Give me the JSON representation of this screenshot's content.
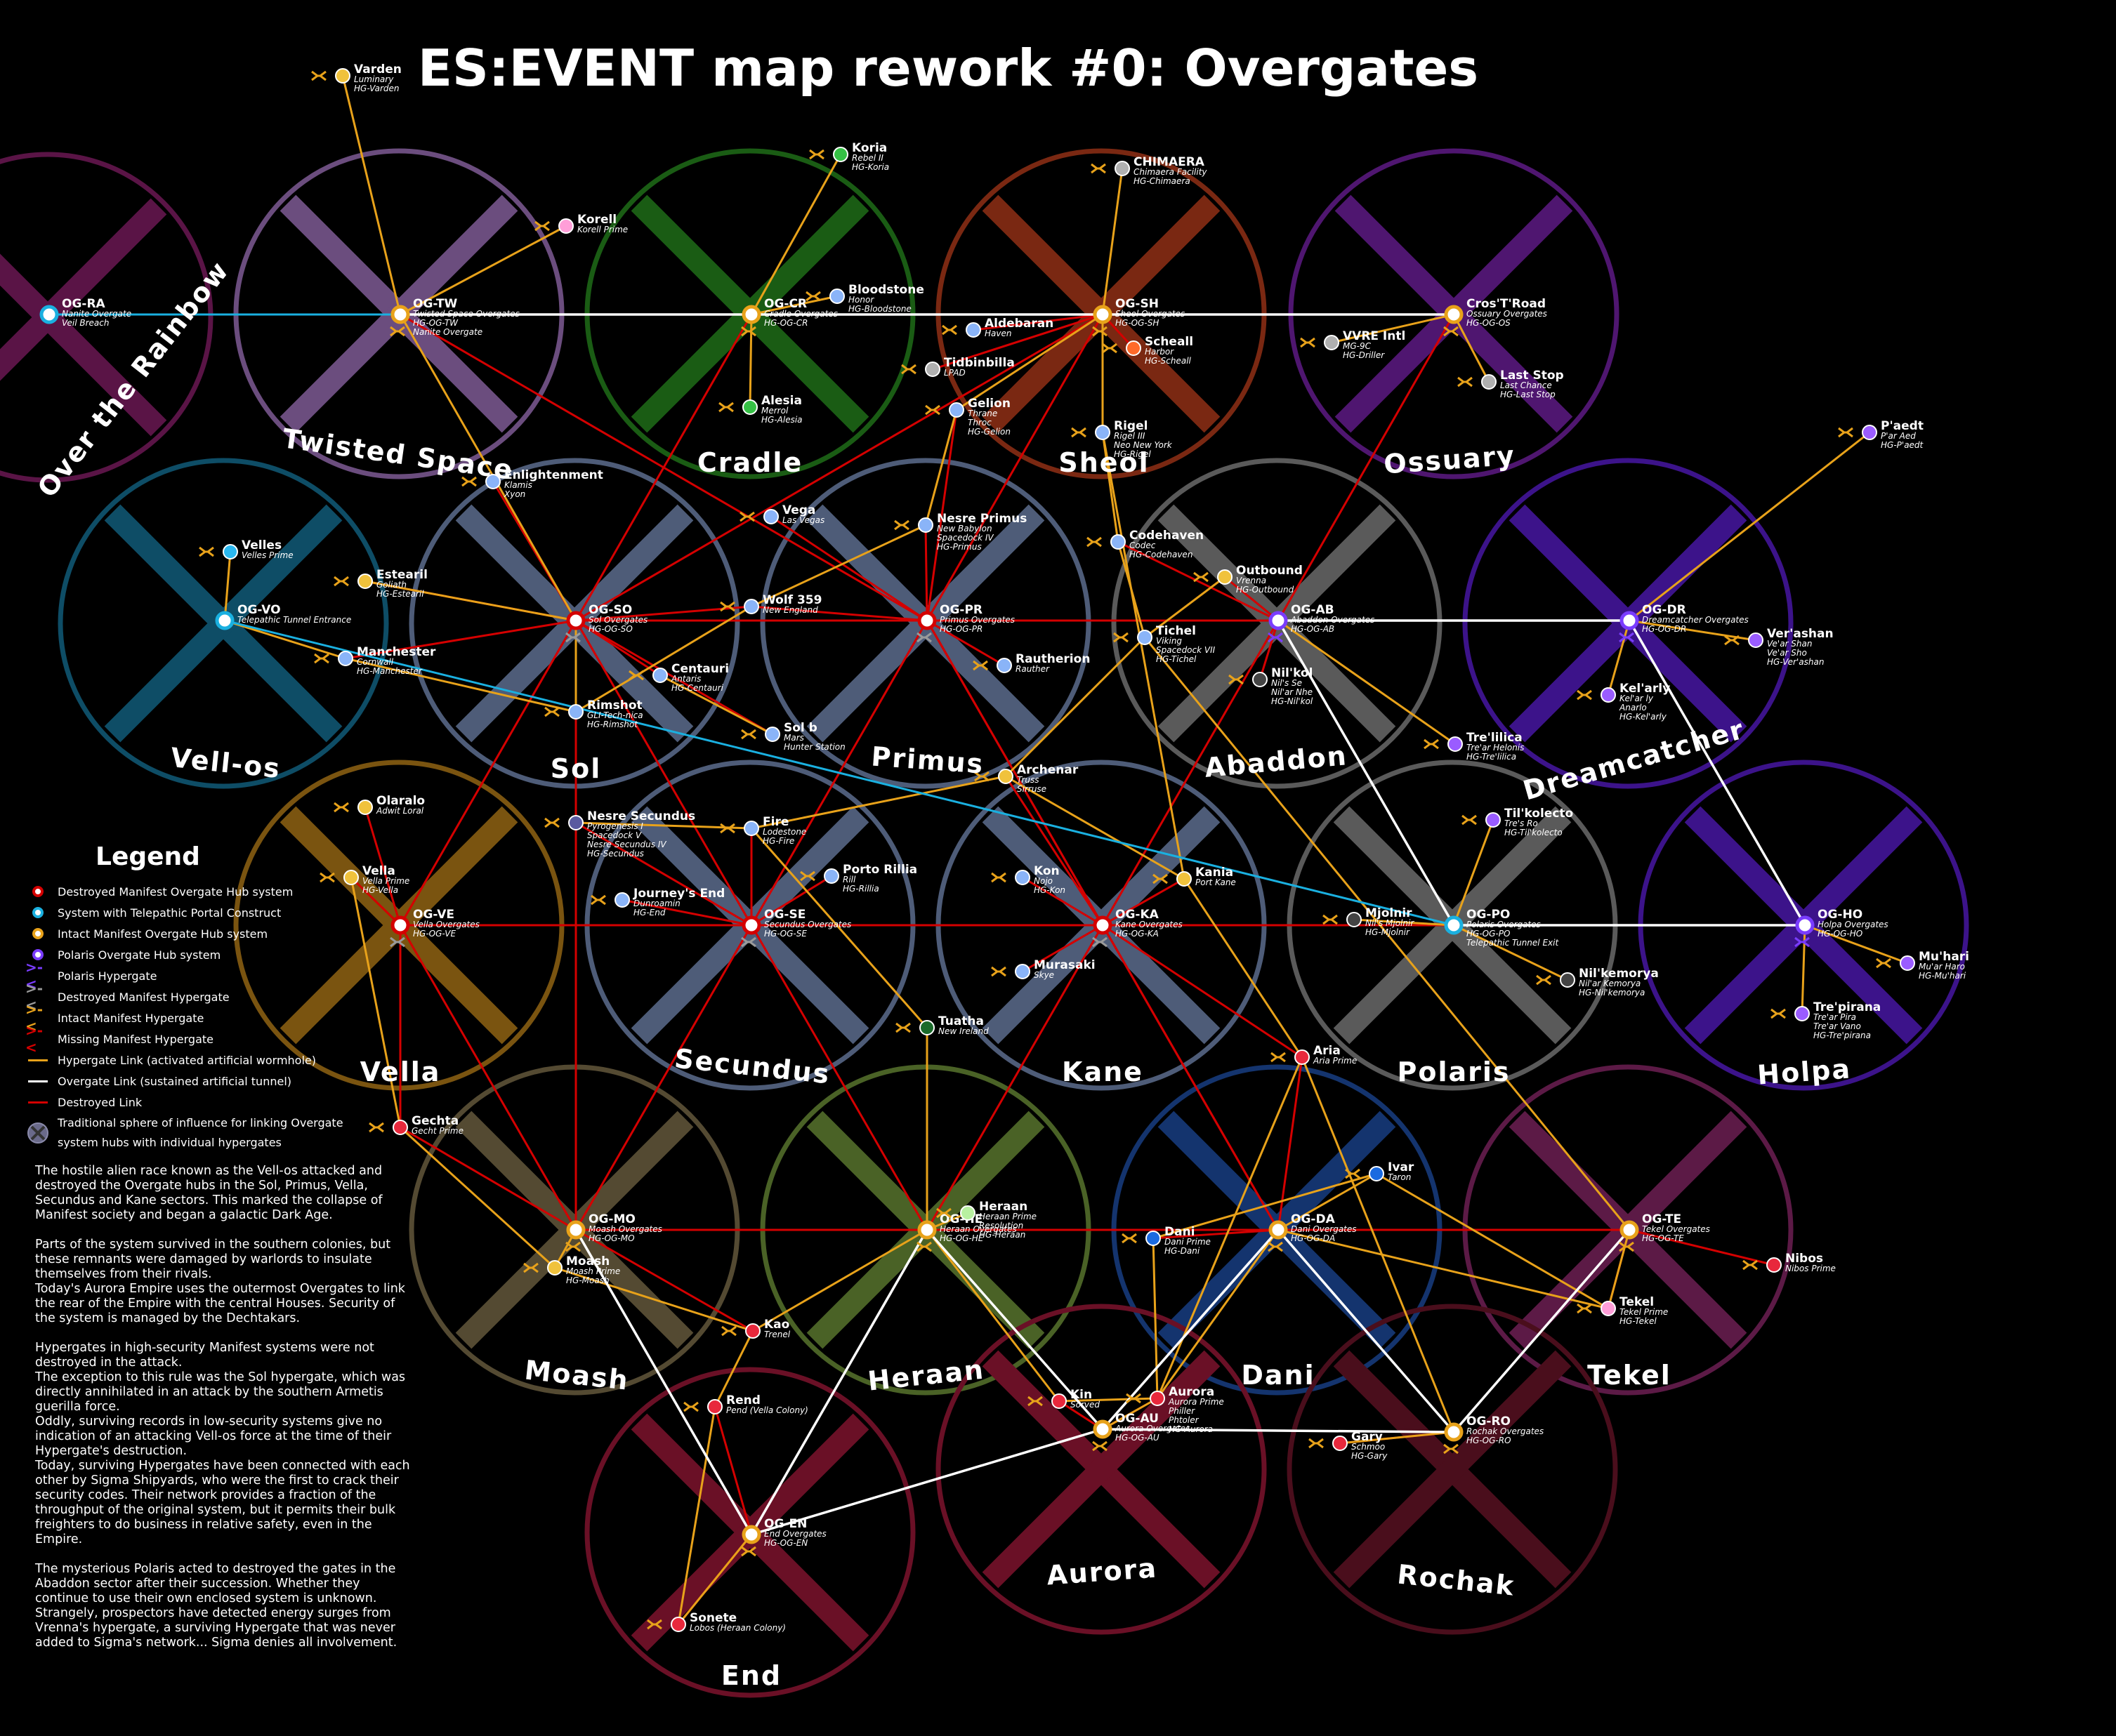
{
  "title": "ES:EVENT map rework #0: Overgates",
  "colors": {
    "background": "#000000",
    "destroyed_link": "#d40000",
    "hypergate_link": "#e8a21a",
    "overgate_link": "#ffffff",
    "telepathic_link": "#1ab0e0"
  },
  "regions": [
    {
      "id": "over-the-rainbow",
      "name": "Over the Rainbow",
      "color": "#5a1446"
    },
    {
      "id": "twisted-space",
      "name": "Twisted Space",
      "color": "#6b4d7e"
    },
    {
      "id": "cradle",
      "name": "Cradle",
      "color": "#1a5c14"
    },
    {
      "id": "sheol",
      "name": "Sheol",
      "color": "#7a2812"
    },
    {
      "id": "ossuary",
      "name": "Ossuary",
      "color": "#4f1670"
    },
    {
      "id": "vell-os",
      "name": "Vell-os",
      "color": "#0e4d66"
    },
    {
      "id": "sol",
      "name": "Sol",
      "color": "#4e5c78"
    },
    {
      "id": "primus",
      "name": "Primus",
      "color": "#4e5c78"
    },
    {
      "id": "abaddon",
      "name": "Abaddon",
      "color": "#5a5a5a"
    },
    {
      "id": "dreamcatcher",
      "name": "Dreamcatcher",
      "color": "#3c138a"
    },
    {
      "id": "vella",
      "name": "Vella",
      "color": "#7a5410"
    },
    {
      "id": "secundus",
      "name": "Secundus",
      "color": "#4e5c78"
    },
    {
      "id": "kane",
      "name": "Kane",
      "color": "#4e5c78"
    },
    {
      "id": "polaris",
      "name": "Polaris",
      "color": "#5a5a5a"
    },
    {
      "id": "holpa",
      "name": "Holpa",
      "color": "#3c138a"
    },
    {
      "id": "moash",
      "name": "Moash",
      "color": "#544a32"
    },
    {
      "id": "heraan",
      "name": "Heraan",
      "color": "#4a6226"
    },
    {
      "id": "dani",
      "name": "Dani",
      "color": "#14346e"
    },
    {
      "id": "tekel",
      "name": "Tekel",
      "color": "#5c1a46"
    },
    {
      "id": "end",
      "name": "End",
      "color": "#6a1026"
    },
    {
      "id": "aurora",
      "name": "Aurora",
      "color": "#6a1026"
    },
    {
      "id": "rochak",
      "name": "Rochak",
      "color": "#4a0e1c"
    }
  ],
  "hubs": [
    {
      "id": "OG-RA",
      "label": "OG-RA",
      "sub": [
        "Nanite Overgate",
        "Veil Breach"
      ],
      "status": "telepathic"
    },
    {
      "id": "OG-TW",
      "label": "OG-TW",
      "sub": [
        "Twisted Space Overgates",
        "HG-OG-TW",
        "Nanite Overgate"
      ],
      "status": "intact"
    },
    {
      "id": "OG-CR",
      "label": "OG-CR",
      "sub": [
        "Cradle Overgates",
        "HG-OG-CR"
      ],
      "status": "intact"
    },
    {
      "id": "OG-SH",
      "label": "OG-SH",
      "sub": [
        "Sheol Overgates",
        "HG-OG-SH"
      ],
      "status": "intact"
    },
    {
      "id": "Cros'T'Road",
      "label": "Cros'T'Road",
      "sub": [
        "Ossuary Overgates",
        "HG-OG-OS"
      ],
      "status": "intact"
    },
    {
      "id": "OG-VO",
      "label": "OG-VO",
      "sub": [
        "Telepathic Tunnel Entrance"
      ],
      "status": "telepathic"
    },
    {
      "id": "OG-SO",
      "label": "OG-SO",
      "sub": [
        "Sol Overgates",
        "HG-OG-SO"
      ],
      "status": "destroyed"
    },
    {
      "id": "OG-PR",
      "label": "OG-PR",
      "sub": [
        "Primus Overgates",
        "HG-OG-PR"
      ],
      "status": "destroyed"
    },
    {
      "id": "OG-AB",
      "label": "OG-AB",
      "sub": [
        "Abaddon Overgates",
        "HG-OG-AB"
      ],
      "status": "polaris"
    },
    {
      "id": "OG-DR",
      "label": "OG-DR",
      "sub": [
        "Dreamcatcher Overgates",
        "HG-OG-DR"
      ],
      "status": "polaris"
    },
    {
      "id": "OG-VE",
      "label": "OG-VE",
      "sub": [
        "Vella Overgates",
        "HG-OG-VE"
      ],
      "status": "destroyed"
    },
    {
      "id": "OG-SE",
      "label": "OG-SE",
      "sub": [
        "Secundus Overgates",
        "HG-OG-SE"
      ],
      "status": "destroyed"
    },
    {
      "id": "OG-KA",
      "label": "OG-KA",
      "sub": [
        "Kane Overgates",
        "HG-OG-KA"
      ],
      "status": "destroyed"
    },
    {
      "id": "OG-PO",
      "label": "OG-PO",
      "sub": [
        "Polaris Overgates",
        "HG-OG-PO",
        "Telepathic Tunnel Exit"
      ],
      "status": "telepathic"
    },
    {
      "id": "OG-HO",
      "label": "OG-HO",
      "sub": [
        "Holpa Overgates",
        "HG-OG-HO"
      ],
      "status": "polaris"
    },
    {
      "id": "OG-MO",
      "label": "OG-MO",
      "sub": [
        "Moash Overgates",
        "HG-OG-MO"
      ],
      "status": "intact"
    },
    {
      "id": "OG-HE",
      "label": "OG-HE",
      "sub": [
        "Heraan Overgates",
        "HG-OG-HE"
      ],
      "status": "intact"
    },
    {
      "id": "OG-DA",
      "label": "OG-DA",
      "sub": [
        "Dani Overgates",
        "HG-OG-DA"
      ],
      "status": "intact"
    },
    {
      "id": "OG-TE",
      "label": "OG-TE",
      "sub": [
        "Tekel Overgates",
        "HG-OG-TE"
      ],
      "status": "intact"
    },
    {
      "id": "OG-EN",
      "label": "OG-EN",
      "sub": [
        "End Overgates",
        "HG-OG-EN"
      ],
      "status": "intact"
    },
    {
      "id": "OG-AU",
      "label": "OG-AU",
      "sub": [
        "Aurora Overgates",
        "HG-OG-AU"
      ],
      "status": "intact"
    },
    {
      "id": "OG-RO",
      "label": "OG-RO",
      "sub": [
        "Rochak Overgates",
        "HG-OG-RO"
      ],
      "status": "intact"
    }
  ],
  "systems": [
    {
      "id": "varden",
      "label": "Varden",
      "sub": [
        "Luminary",
        "HG-Varden"
      ],
      "color": "#f0c23c"
    },
    {
      "id": "korell",
      "label": "Korell",
      "sub": [
        "Korell Prime"
      ],
      "color": "#ff9ed8"
    },
    {
      "id": "koria",
      "label": "Koria",
      "sub": [
        "Rebel II",
        "HG-Koria"
      ],
      "color": "#35c045"
    },
    {
      "id": "bloodstone",
      "label": "Bloodstone",
      "sub": [
        "Honor",
        "HG-Bloodstone"
      ],
      "color": "#8ab4f8"
    },
    {
      "id": "alesia",
      "label": "Alesia",
      "sub": [
        "Merrol",
        "HG-Alesia"
      ],
      "color": "#35c045"
    },
    {
      "id": "chimaera",
      "label": "CHIMAERA",
      "sub": [
        "Chimaera Facility",
        "HG-Chimaera"
      ],
      "color": "#b0b0b0"
    },
    {
      "id": "aldebaran",
      "label": "Aldebaran",
      "sub": [
        "Haven"
      ],
      "color": "#8ab4f8"
    },
    {
      "id": "scheall",
      "label": "Scheall",
      "sub": [
        "Harbor",
        "HG-Scheall"
      ],
      "color": "#ff6a2a"
    },
    {
      "id": "tidbinbilla",
      "label": "Tidbinbilla",
      "sub": [
        "LPAD"
      ],
      "color": "#b0b0b0"
    },
    {
      "id": "gelion",
      "label": "Gelion",
      "sub": [
        "Thrane",
        "Throc",
        "HG-Gelion"
      ],
      "color": "#8ab4f8"
    },
    {
      "id": "rigel",
      "label": "Rigel",
      "sub": [
        "Rigel III",
        "Neo New York",
        "HG-Rigel"
      ],
      "color": "#8ab4f8"
    },
    {
      "id": "vvre",
      "label": "VVRE Intl",
      "sub": [
        "MG-9C",
        "HG-Driller"
      ],
      "color": "#b0b0b0"
    },
    {
      "id": "last-stop",
      "label": "Last Stop",
      "sub": [
        "Last Chance",
        "HG-Last Stop"
      ],
      "color": "#b0b0b0"
    },
    {
      "id": "paedt",
      "label": "P'aedt",
      "sub": [
        "P'ar Aed",
        "HG-P'aedt"
      ],
      "color": "#9a5cff"
    },
    {
      "id": "velles",
      "label": "Velles",
      "sub": [
        "Velles Prime"
      ],
      "color": "#2ab8f0"
    },
    {
      "id": "enlightenment",
      "label": "Enlightenment",
      "sub": [
        "Klamis",
        "Xyon"
      ],
      "color": "#8ab4f8"
    },
    {
      "id": "estearil",
      "label": "Estearil",
      "sub": [
        "Goliath",
        "HG-Estearil"
      ],
      "color": "#f0c23c"
    },
    {
      "id": "vega",
      "label": "Vega",
      "sub": [
        "Las Vegas"
      ],
      "color": "#8ab4f8"
    },
    {
      "id": "nesre-primus",
      "label": "Nesre Primus",
      "sub": [
        "New Babylon",
        "Spacedock IV",
        "HG-Primus"
      ],
      "color": "#8ab4f8"
    },
    {
      "id": "codehaven",
      "label": "Codehaven",
      "sub": [
        "Codec",
        "HG-Codehaven"
      ],
      "color": "#8ab4f8"
    },
    {
      "id": "outbound",
      "label": "Outbound",
      "sub": [
        "Vrenna",
        "HG-Outbound"
      ],
      "color": "#f0c23c"
    },
    {
      "id": "wolf-359",
      "label": "Wolf 359",
      "sub": [
        "New England"
      ],
      "color": "#8ab4f8"
    },
    {
      "id": "tichel",
      "label": "Tichel",
      "sub": [
        "Viking",
        "Spacedock VII",
        "HG-Tichel"
      ],
      "color": "#8ab4f8"
    },
    {
      "id": "manchester",
      "label": "Manchester",
      "sub": [
        "Cornwall",
        "HG-Manchester"
      ],
      "color": "#8ab4f8"
    },
    {
      "id": "centauri",
      "label": "Centauri",
      "sub": [
        "Antaris",
        "HG-Centauri"
      ],
      "color": "#8ab4f8"
    },
    {
      "id": "rautherion",
      "label": "Rautherion",
      "sub": [
        "Rauther"
      ],
      "color": "#8ab4f8"
    },
    {
      "id": "nilkol",
      "label": "Nil'kol",
      "sub": [
        "Nil's Se",
        "Nil'ar Nhe",
        "HG-Nil'kol"
      ],
      "color": "#444444"
    },
    {
      "id": "verashan",
      "label": "Ver'ashan",
      "sub": [
        "Ve'ar Shan",
        "Ve'ar Sho",
        "HG-Ver'ashan"
      ],
      "color": "#9a5cff"
    },
    {
      "id": "kelarly",
      "label": "Kel'arly",
      "sub": [
        "Kel'ar ly",
        "Anarlo",
        "HG-Kel'arly"
      ],
      "color": "#9a5cff"
    },
    {
      "id": "rimshot",
      "label": "Rimshot",
      "sub": [
        "GLI-Tech-nica",
        "HG-Rimshot"
      ],
      "color": "#8ab4f8"
    },
    {
      "id": "sol-b",
      "label": "Sol b",
      "sub": [
        "Mars",
        "Hunter Station"
      ],
      "color": "#8ab4f8"
    },
    {
      "id": "trelilica",
      "label": "Tre'lilica",
      "sub": [
        "Tre'ar Helonis",
        "HG-Tre'lilica"
      ],
      "color": "#9a5cff"
    },
    {
      "id": "archenar",
      "label": "Archenar",
      "sub": [
        "Truss",
        "Sirruse"
      ],
      "color": "#f0c23c"
    },
    {
      "id": "olaralo",
      "label": "Olaralo",
      "sub": [
        "Adwit Loral"
      ],
      "color": "#f0c23c"
    },
    {
      "id": "nesre-secundus",
      "label": "Nesre Secundus",
      "sub": [
        "Pyrogenesis I",
        "Spacedock V",
        "Nesre Secundus IV",
        "HG-Secundus"
      ],
      "color": "#5a5aa0"
    },
    {
      "id": "fire",
      "label": "Fire",
      "sub": [
        "Lodestone",
        "HG-Fire"
      ],
      "color": "#8ab4f8"
    },
    {
      "id": "tilkolecto",
      "label": "Til'kolecto",
      "sub": [
        "Tre's Ro",
        "HG-Til'kolecto"
      ],
      "color": "#9a5cff"
    },
    {
      "id": "vella",
      "label": "Vella",
      "sub": [
        "Vella Prime",
        "HG-Vella"
      ],
      "color": "#f0c23c"
    },
    {
      "id": "porto-rillia",
      "label": "Porto Rillia",
      "sub": [
        "Rill",
        "HG-Rillia"
      ],
      "color": "#8ab4f8"
    },
    {
      "id": "kon",
      "label": "Kon",
      "sub": [
        "Nojo",
        "HG-Kon"
      ],
      "color": "#8ab4f8"
    },
    {
      "id": "kania",
      "label": "Kania",
      "sub": [
        "Port Kane"
      ],
      "color": "#f0c23c"
    },
    {
      "id": "journeys-end",
      "label": "Journey's End",
      "sub": [
        "Dunroamin",
        "HG-End"
      ],
      "color": "#8ab4f8"
    },
    {
      "id": "mjolnir",
      "label": "Mjolnir",
      "sub": [
        "Nil's Mjolnir",
        "HG-Mjolnir"
      ],
      "color": "#444444"
    },
    {
      "id": "murasaki",
      "label": "Murasaki",
      "sub": [
        "Skye"
      ],
      "color": "#8ab4f8"
    },
    {
      "id": "nilkemorya",
      "label": "Nil'kemorya",
      "sub": [
        "Nil'ar Kemorya",
        "HG-Nil'kemorya"
      ],
      "color": "#444444"
    },
    {
      "id": "muhari",
      "label": "Mu'hari",
      "sub": [
        "Mu'ar Haro",
        "HG-Mu'hari"
      ],
      "color": "#9a5cff"
    },
    {
      "id": "trepirana",
      "label": "Tre'pirana",
      "sub": [
        "Tre'ar Pira",
        "Tre'ar Vano",
        "HG-Tre'pirana"
      ],
      "color": "#9a5cff"
    },
    {
      "id": "tuatha",
      "label": "Tuatha",
      "sub": [
        "New Ireland"
      ],
      "color": "#1a6a2a"
    },
    {
      "id": "aria",
      "label": "Aria",
      "sub": [
        "Aria Prime"
      ],
      "color": "#e8283c"
    },
    {
      "id": "gechta",
      "label": "Gechta",
      "sub": [
        "Gecht Prime"
      ],
      "color": "#e8283c"
    },
    {
      "id": "heraan",
      "label": "Heraan",
      "sub": [
        "Heraan Prime",
        "Resolution",
        "HG-Heraan"
      ],
      "color": "#b8f0a0"
    },
    {
      "id": "ivar",
      "label": "Ivar",
      "sub": [
        "Taron"
      ],
      "color": "#1a6ae0"
    },
    {
      "id": "dani",
      "label": "Dani",
      "sub": [
        "Dani Prime",
        "HG-Dani"
      ],
      "color": "#1a6ae0"
    },
    {
      "id": "moash",
      "label": "Moash",
      "sub": [
        "Moash Prime",
        "HG-Moash"
      ],
      "color": "#f0c23c"
    },
    {
      "id": "nibos",
      "label": "Nibos",
      "sub": [
        "Nibos Prime"
      ],
      "color": "#e8283c"
    },
    {
      "id": "tekel",
      "label": "Tekel",
      "sub": [
        "Tekel Prime",
        "HG-Tekel"
      ],
      "color": "#ff9ed8"
    },
    {
      "id": "kao",
      "label": "Kao",
      "sub": [
        "Trenel"
      ],
      "color": "#e8283c"
    },
    {
      "id": "rend",
      "label": "Rend",
      "sub": [
        "Pend (Vella Colony)"
      ],
      "color": "#e8283c"
    },
    {
      "id": "kin",
      "label": "Kin",
      "sub": [
        "Sorved"
      ],
      "color": "#e8283c"
    },
    {
      "id": "aurora",
      "label": "Aurora",
      "sub": [
        "Aurora Prime",
        "Philler",
        "Phtoler",
        "HG-Aurora"
      ],
      "color": "#e8283c"
    },
    {
      "id": "gary",
      "label": "Gary",
      "sub": [
        "Schmoo",
        "HG-Gary"
      ],
      "color": "#e8283c"
    },
    {
      "id": "sonete",
      "label": "Sonete",
      "sub": [
        "Lobos (Heraan Colony)"
      ],
      "color": "#e8283c"
    }
  ],
  "legend": {
    "title": "Legend",
    "items": [
      {
        "label": "Destroyed Manifest Overgate Hub system",
        "kind": "hub",
        "color": "#d40000"
      },
      {
        "label": "System with Telepathic Portal Construct",
        "kind": "hub",
        "color": "#1ab0e0"
      },
      {
        "label": "Intact Manifest Overgate Hub system",
        "kind": "hub",
        "color": "#e8a21a"
      },
      {
        "label": "Polaris Overgate Hub system",
        "kind": "hub",
        "color": "#7a3cff"
      },
      {
        "label": "Polaris Hypergate",
        "kind": "gate",
        "color": "#7a3cff"
      },
      {
        "label": "Destroyed Manifest Hypergate",
        "kind": "gate",
        "color": "#9a9a9a"
      },
      {
        "label": "Intact Manifest Hypergate",
        "kind": "gate",
        "color": "#e8a21a"
      },
      {
        "label": "Missing Manifest Hypergate",
        "kind": "gate",
        "color": "#d40000"
      },
      {
        "label": "Hypergate Link (activated artificial wormhole)",
        "kind": "line",
        "color": "#e8a21a"
      },
      {
        "label": "Overgate Link (sustained artificial tunnel)",
        "kind": "line",
        "color": "#ffffff"
      },
      {
        "label": "Destroyed Link",
        "kind": "line",
        "color": "#d40000"
      },
      {
        "label": "Traditional sphere of influence for linking Overgate system hubs with individual hypergates",
        "kind": "sphere",
        "color": "#7a7a9a"
      }
    ]
  },
  "notes": [
    "The hostile alien race known as the Vell-os attacked and destroyed the Overgate hubs in the Sol, Primus, Vella, Secundus and Kane sectors. This marked the collapse of Manifest society and began a galactic Dark Age.",
    "Parts of the system survived in the southern colonies, but these remnants were damaged by warlords to insulate themselves from their rivals.\nToday's Aurora Empire uses the outermost Overgates to link the rear of the Empire with the central Houses. Security of the system is managed by the Dechtakars.",
    "Hypergates in high-security Manifest systems were not destroyed in the attack.\nThe exception to this rule was the Sol hypergate, which was directly annihilated in an attack by the southern Armetis guerilla force.\nOddly, surviving records in low-security systems give no indication of an attacking Vell-os force at the time of their Hypergate's destruction.\nToday, surviving Hypergates have been connected with each other by Sigma Shipyards, who were the first to crack their security codes. Their network provides a fraction of the throughput of the original system, but it permits their bulk freighters to do business in relative safety, even in the Empire.",
    "The mysterious Polaris acted to destroyed the gates in the Abaddon sector after their succession. Whether they continue to use their own enclosed system is unknown. Strangely, prospectors have detected energy surges from Vrenna's hypergate, a surviving Hypergate that was never added to Sigma's network... Sigma denies all involvement."
  ]
}
